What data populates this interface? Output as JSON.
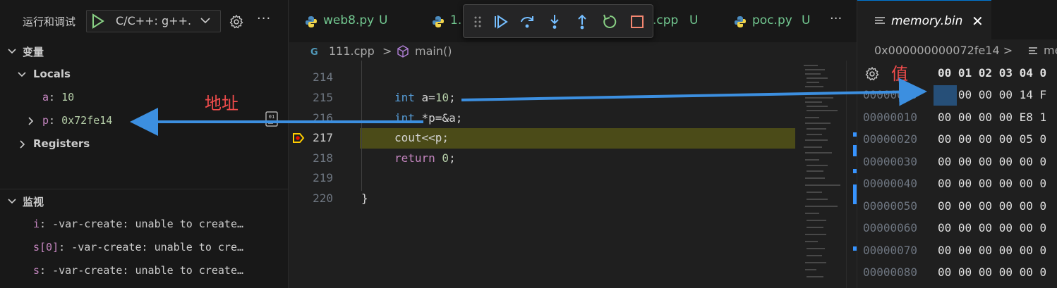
{
  "debug_panel": {
    "run_title": "运行和调试",
    "config": "C/C++: g++.",
    "more": "···",
    "variables": {
      "header": "变量",
      "locals_label": "Locals",
      "items": [
        {
          "name": "a",
          "sep": ": ",
          "value": "10"
        },
        {
          "name": "p",
          "sep": ": ",
          "value": "0x72fe14"
        }
      ],
      "registers_label": "Registers"
    },
    "watch": {
      "header": "监视",
      "items": [
        {
          "name": "i",
          "text": ": -var-create: unable to create…"
        },
        {
          "name": "s[0]",
          "text": ": -var-create: unable to cre…"
        },
        {
          "name": "s",
          "text": ": -var-create: unable to create…"
        }
      ]
    },
    "annotation_address": "地址"
  },
  "editor": {
    "tabs": [
      {
        "name": "web8.py",
        "badge": "U"
      },
      {
        "name": "1.",
        "badge": ""
      },
      {
        "name": ".cpp",
        "badge": "U"
      },
      {
        "name": "poc.py",
        "badge": "U"
      }
    ],
    "more": "···",
    "breadcrumb": {
      "file": "111.cpp",
      "sep": ">",
      "symbol": "main()"
    },
    "lines": [
      {
        "num": "214"
      },
      {
        "num": "215"
      },
      {
        "num": "216"
      },
      {
        "num": "217"
      },
      {
        "num": "218"
      },
      {
        "num": "219"
      },
      {
        "num": "220"
      }
    ],
    "code": {
      "l215_kw": "int",
      "l215_rest": " a=",
      "l215_num": "10",
      "l215_end": ";",
      "l216_kw": "int",
      "l216_rest": " *p=&a;",
      "l217": "cout<<p;",
      "l218_kw": "return",
      "l218_num": " 0",
      "l218_end": ";",
      "l220": "}"
    },
    "current_line": "217"
  },
  "memory": {
    "tab_title": "memory.bin",
    "close": "✕",
    "breadcrumb": "0x000000000072fe14",
    "breadcrumb_sep": ">",
    "breadcrumb_next": "me",
    "annotation_value": "值",
    "header": "00 01 02 03 04 0",
    "rows": [
      {
        "addr": "00000000",
        "bytes": "0A 00 00 00 14 F"
      },
      {
        "addr": "00000010",
        "bytes": "00 00 00 00 E8 1"
      },
      {
        "addr": "00000020",
        "bytes": "00 00 00 00 05 0"
      },
      {
        "addr": "00000030",
        "bytes": "00 00 00 00 00 0"
      },
      {
        "addr": "00000040",
        "bytes": "00 00 00 00 00 0"
      },
      {
        "addr": "00000050",
        "bytes": "00 00 00 00 00 0"
      },
      {
        "addr": "00000060",
        "bytes": "00 00 00 00 00 0"
      },
      {
        "addr": "00000070",
        "bytes": "00 00 00 00 00 0"
      },
      {
        "addr": "00000080",
        "bytes": "00 00 00 00 00 0"
      }
    ]
  },
  "colors": {
    "accent": "#0078d4",
    "annotation_red": "#f14c4c",
    "arrow_blue": "#3c8fe0",
    "debug_line_highlight": "#4b4b18",
    "untracked_green": "#73c991"
  }
}
